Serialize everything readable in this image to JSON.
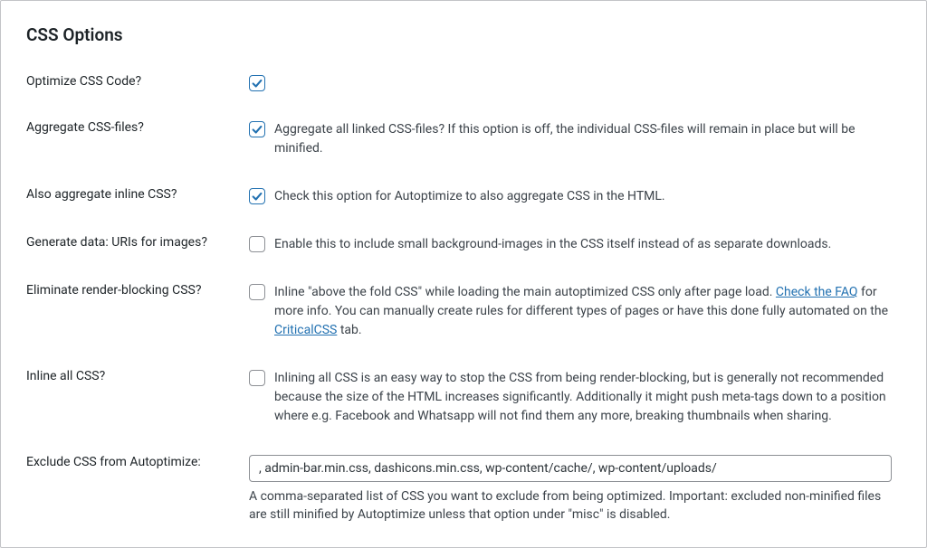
{
  "section": {
    "title": "CSS Options"
  },
  "options": {
    "optimize": {
      "label": "Optimize CSS Code?",
      "checked": true
    },
    "aggregate": {
      "label": "Aggregate CSS-files?",
      "checked": true,
      "desc": "Aggregate all linked CSS-files? If this option is off, the individual CSS-files will remain in place but will be minified."
    },
    "inline_agg": {
      "label": "Also aggregate inline CSS?",
      "checked": true,
      "desc": "Check this option for Autoptimize to also aggregate CSS in the HTML."
    },
    "datauri": {
      "label": "Generate data: URIs for images?",
      "checked": false,
      "desc": "Enable this to include small background-images in the CSS itself instead of as separate downloads."
    },
    "eliminate": {
      "label": "Eliminate render-blocking CSS?",
      "checked": false,
      "desc_pre": "Inline \"above the fold CSS\" while loading the main autoptimized CSS only after page load. ",
      "link1": "Check the FAQ",
      "desc_mid": " for more info. You can manually create rules for different types of pages or have this done fully automated on the ",
      "link2": "CriticalCSS",
      "desc_post": " tab."
    },
    "inline_all": {
      "label": "Inline all CSS?",
      "checked": false,
      "desc": "Inlining all CSS is an easy way to stop the CSS from being render-blocking, but is generally not recommended because the size of the HTML increases significantly. Additionally it might push meta-tags down to a position where e.g. Facebook and Whatsapp will not find them any more, breaking thumbnails when sharing."
    },
    "exclude": {
      "label": "Exclude CSS from Autoptimize:",
      "value": ", admin-bar.min.css, dashicons.min.css, wp-content/cache/, wp-content/uploads/",
      "help": "A comma-separated list of CSS you want to exclude from being optimized. Important: excluded non-minified files are still minified by Autoptimize unless that option under \"misc\" is disabled."
    }
  }
}
